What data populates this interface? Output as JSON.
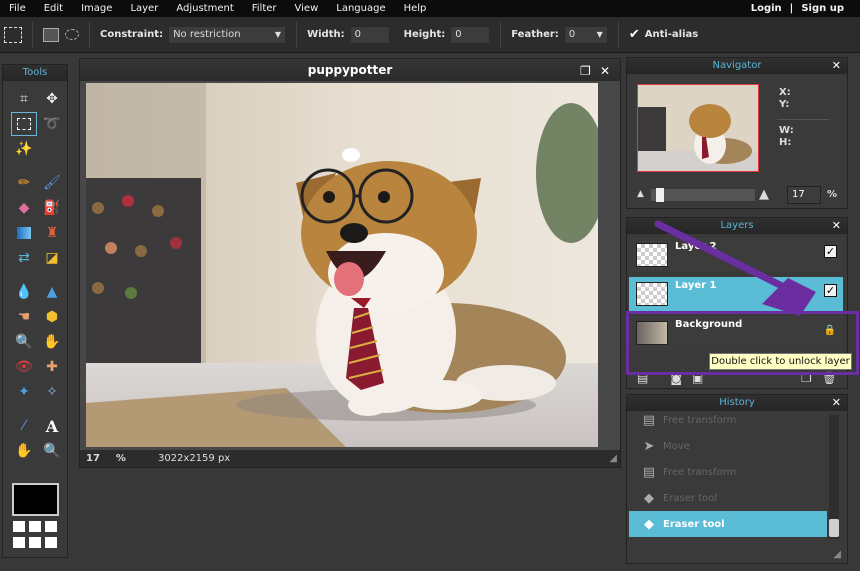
{
  "menu": [
    "File",
    "Edit",
    "Image",
    "Layer",
    "Adjustment",
    "Filter",
    "View",
    "Language",
    "Help"
  ],
  "auth": {
    "login": "Login",
    "divider": "|",
    "signup": "Sign up"
  },
  "options": {
    "constraint_label": "Constraint:",
    "constraint_value": "No restriction",
    "width_label": "Width:",
    "width_value": "0",
    "height_label": "Height:",
    "height_value": "0",
    "feather_label": "Feather:",
    "feather_value": "0",
    "antialias_label": "Anti-alias",
    "antialias_checked": true
  },
  "tools": {
    "title": "Tools"
  },
  "canvas": {
    "title": "puppypotter",
    "zoom": "17",
    "zoom_unit": "%",
    "dimensions": "3022x2159 px"
  },
  "navigator": {
    "title": "Navigator",
    "x_label": "X:",
    "y_label": "Y:",
    "w_label": "W:",
    "h_label": "H:",
    "zoom": "17",
    "zoom_unit": "%",
    "zoom_fraction": 0.05
  },
  "layers": {
    "title": "Layers",
    "items": [
      {
        "name": "Layer 2",
        "visible": true
      },
      {
        "name": "Layer 1",
        "visible": true
      },
      {
        "name": "Background",
        "locked": true
      }
    ],
    "tooltip": "Double click to unlock layer"
  },
  "history": {
    "title": "History",
    "items": [
      {
        "label": "Free transform"
      },
      {
        "label": "Move"
      },
      {
        "label": "Free transform"
      },
      {
        "label": "Eraser tool"
      },
      {
        "label": "Eraser tool"
      }
    ]
  },
  "colors": {
    "accent": "#5bbcd6",
    "annotation": "#6a2ea0",
    "menubar": "#0c0c0c"
  }
}
